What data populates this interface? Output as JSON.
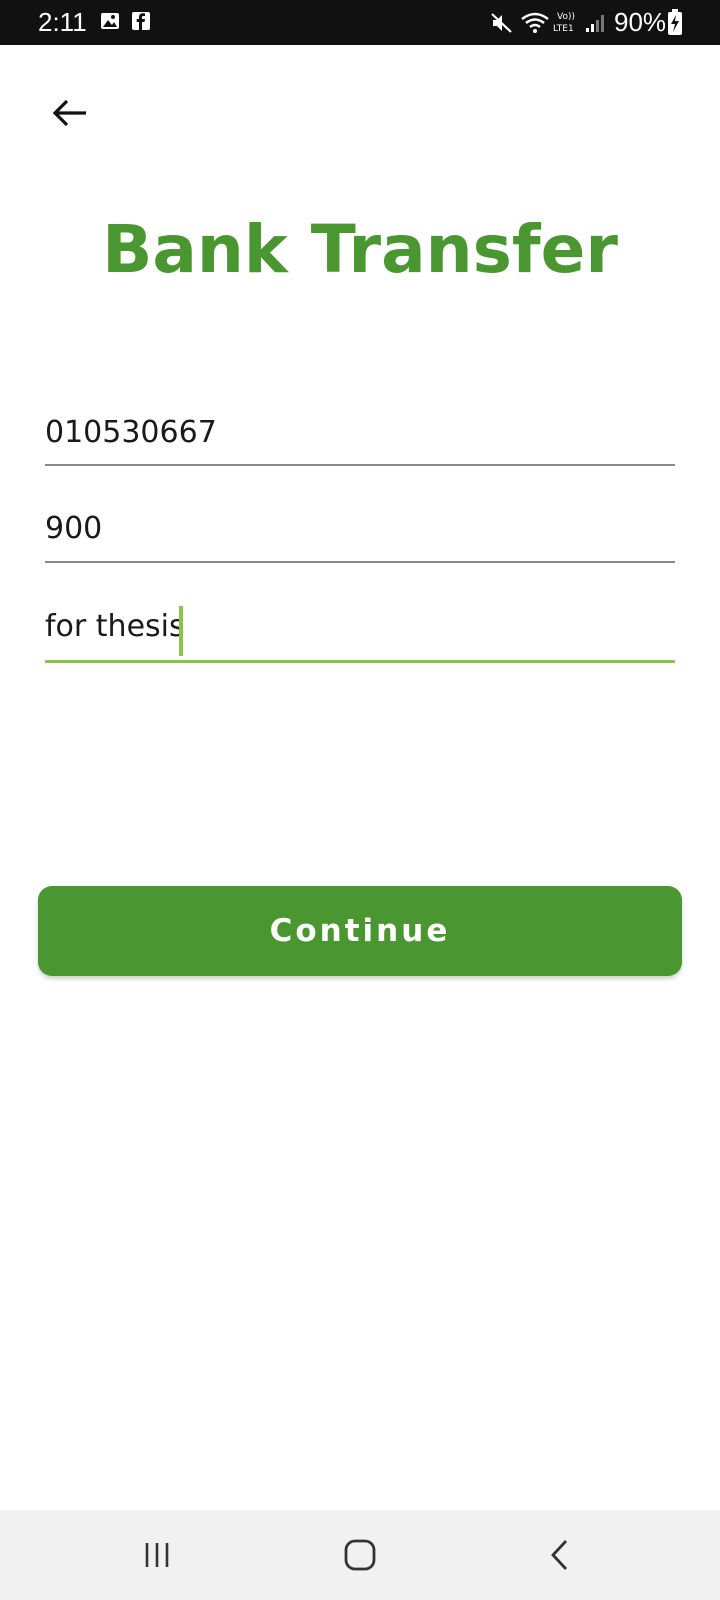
{
  "status_bar": {
    "time": "2:11",
    "battery": "90%",
    "icons": [
      "image-icon",
      "facebook-icon",
      "mute-icon",
      "wifi-icon",
      "volte-icon",
      "signal-icon",
      "battery-charging-icon"
    ]
  },
  "header": {
    "back_icon": "arrow-left-icon",
    "title": "Bank Transfer"
  },
  "form": {
    "account_number": "010530667",
    "amount": "900",
    "remarks": "for thesis"
  },
  "actions": {
    "continue_label": "Continue"
  },
  "nav_bar": {
    "icons": [
      "recent-apps-icon",
      "home-icon",
      "back-icon"
    ]
  },
  "colors": {
    "brand_green": "#4a9631",
    "focus_green": "#8bc34a",
    "underline_gray": "#8a8a8a",
    "status_bar_bg": "#111111",
    "nav_bar_bg": "#f1f1f1"
  }
}
